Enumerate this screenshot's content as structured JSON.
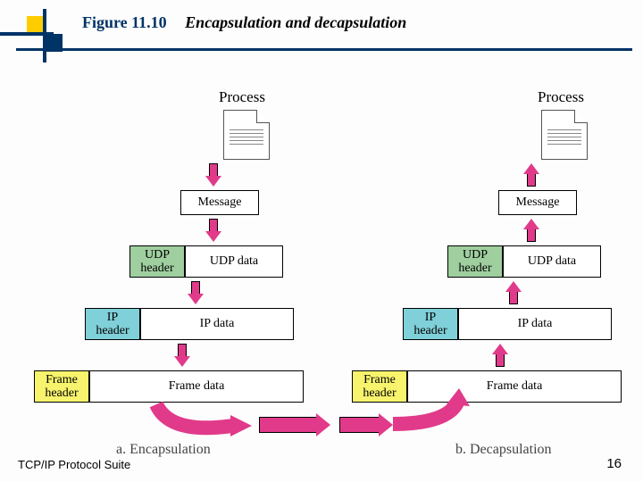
{
  "figure": {
    "number": "Figure 11.10",
    "caption": "Encapsulation and decapsulation"
  },
  "labels": {
    "process": "Process",
    "message": "Message",
    "udp_header": "UDP header",
    "udp_data": "UDP  data",
    "ip_header": "IP header",
    "ip_data": "IP data",
    "frame_header": "Frame header",
    "frame_data": "Frame data"
  },
  "subcaptions": {
    "a": "a. Encapsulation",
    "b": "b. Decapsulation"
  },
  "footer": {
    "left": "TCP/IP Protocol Suite",
    "right": "16"
  },
  "diagram_data": {
    "type": "layered-packet",
    "columns": [
      {
        "id": "a",
        "title": "Encapsulation",
        "direction": "down",
        "layers": [
          "Process",
          "Message",
          "UDP",
          "IP",
          "Frame"
        ]
      },
      {
        "id": "b",
        "title": "Decapsulation",
        "direction": "up",
        "layers": [
          "Frame",
          "IP",
          "UDP",
          "Message",
          "Process"
        ]
      }
    ],
    "layer_schema": [
      {
        "name": "Message",
        "header": null,
        "payload": "Message"
      },
      {
        "name": "UDP",
        "header": "UDP header",
        "payload": "UDP data"
      },
      {
        "name": "IP",
        "header": "IP header",
        "payload": "IP data"
      },
      {
        "name": "Frame",
        "header": "Frame header",
        "payload": "Frame data"
      }
    ]
  }
}
